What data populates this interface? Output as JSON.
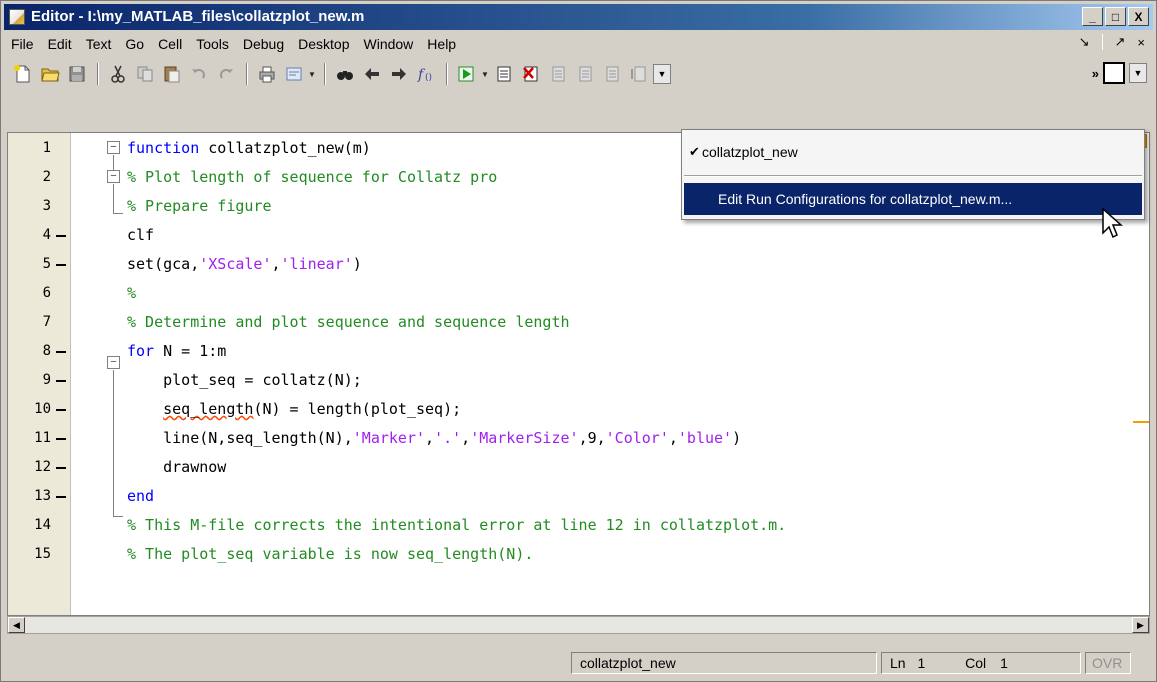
{
  "window": {
    "title": "Editor - I:\\my_MATLAB_files\\collatzplot_new.m",
    "min_label": "_",
    "max_label": "□",
    "close_label": "X"
  },
  "menu": {
    "items": [
      "File",
      "Edit",
      "Text",
      "Go",
      "Cell",
      "Tools",
      "Debug",
      "Desktop",
      "Window",
      "Help"
    ],
    "dock_label": "↘",
    "undock_label": "↗",
    "close_label": "×"
  },
  "toolbar": {
    "icons": [
      "new-file-icon",
      "open-folder-icon",
      "save-icon",
      "cut-icon",
      "copy-icon",
      "paste-icon",
      "undo-icon",
      "redo-icon",
      "print-icon",
      "comment-icon",
      "find-icon",
      "back-icon",
      "forward-icon",
      "function-icon",
      "run-icon",
      "set-breakpoint-icon",
      "clear-breakpoint-icon",
      "step-icon",
      "step-in-icon",
      "step-out-icon",
      "exit-debug-icon"
    ],
    "overflow_label": "»"
  },
  "editor": {
    "lines": [
      {
        "num": "1",
        "dash": false
      },
      {
        "num": "2",
        "dash": false
      },
      {
        "num": "3",
        "dash": false
      },
      {
        "num": "4",
        "dash": true
      },
      {
        "num": "5",
        "dash": true
      },
      {
        "num": "6",
        "dash": false
      },
      {
        "num": "7",
        "dash": false
      },
      {
        "num": "8",
        "dash": true
      },
      {
        "num": "9",
        "dash": true
      },
      {
        "num": "10",
        "dash": true
      },
      {
        "num": "11",
        "dash": true
      },
      {
        "num": "12",
        "dash": true
      },
      {
        "num": "13",
        "dash": true
      },
      {
        "num": "14",
        "dash": false
      },
      {
        "num": "15",
        "dash": false
      }
    ],
    "code": {
      "l1_kw": "function",
      "l1_rest": " collatzplot_new(m)",
      "l2": "% Plot length of sequence for Collatz pro",
      "l3": "% Prepare figure",
      "l4": "clf",
      "l5_a": "set(gca,",
      "l5_s1": "'XScale'",
      "l5_b": ",",
      "l5_s2": "'linear'",
      "l5_c": ")",
      "l6": "%",
      "l7": "% Determine and plot sequence and sequence length",
      "l8_kw": "for",
      "l8_rest": " N = 1:m",
      "l9": "    plot_seq = collatz(N);",
      "l10_indent": "    ",
      "l10_sq": "seq_length",
      "l10_rest": "(N) = length(plot_seq);",
      "l11_a": "    line(N,seq_length(N),",
      "l11_s1": "'Marker'",
      "l11_b": ",",
      "l11_s2": "'.'",
      "l11_c": ",",
      "l11_s3": "'MarkerSize'",
      "l11_d": ",9,",
      "l11_s4": "'Color'",
      "l11_e": ",",
      "l11_s5": "'blue'",
      "l11_f": ")",
      "l12": "    drawnow",
      "l13_kw": "end",
      "l14": "% This M-file corrects the intentional error at line 12 in collatzplot.m.",
      "l15": "% The plot_seq variable is now seq_length(N)."
    }
  },
  "dropdown": {
    "item1": "collatzplot_new",
    "item1_checked": true,
    "item2": "Edit Run Configurations for collatzplot_new.m..."
  },
  "status": {
    "function_name": "collatzplot_new",
    "ln_label": "Ln",
    "ln_value": "1",
    "col_label": "Col",
    "col_value": "1",
    "mode": "OVR"
  },
  "colors": {
    "keyword": "#0000ff",
    "string": "#a020f0",
    "comment": "#228b22",
    "selection": "#0a246a"
  }
}
